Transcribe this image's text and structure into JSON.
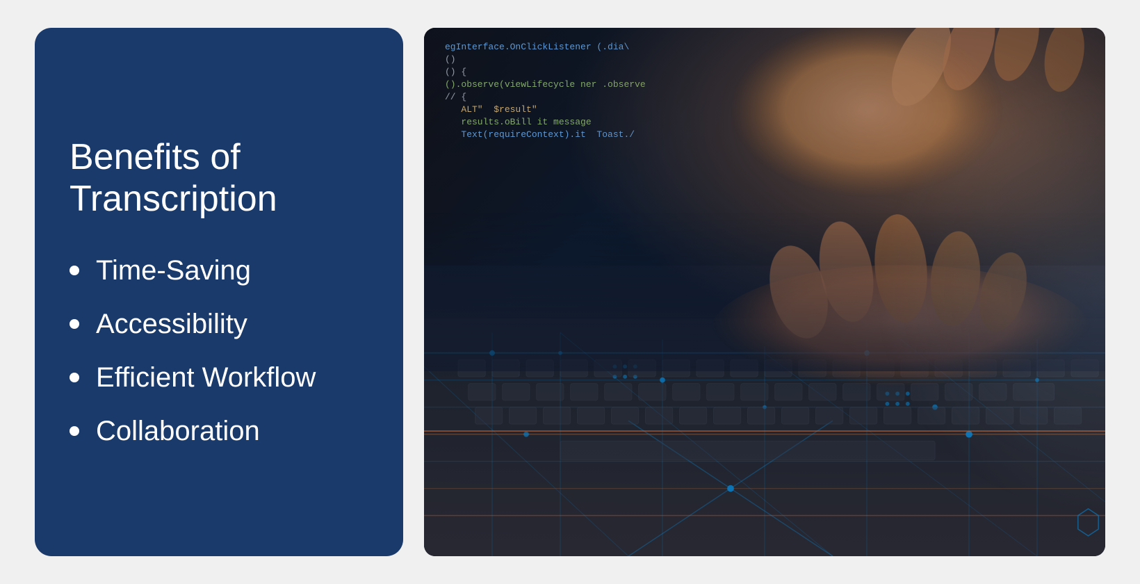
{
  "slide": {
    "left_panel": {
      "title_line1": "Benefits of",
      "title_line2": "Transcription",
      "bullet_items": [
        {
          "id": "time-saving",
          "label": "Time-Saving"
        },
        {
          "id": "accessibility",
          "label": "Accessibility"
        },
        {
          "id": "efficient-workflow",
          "label": "Efficient Workflow"
        },
        {
          "id": "collaboration",
          "label": "Collaboration"
        }
      ]
    },
    "right_panel": {
      "alt_text": "Hands typing on a keyboard with digital circuit overlay and code in background",
      "code_lines": [
        {
          "text": "egInterface.OnClickListener (.dia\\",
          "class": "blue"
        },
        {
          "text": "()",
          "class": "white"
        },
        {
          "text": "() {",
          "class": "white"
        },
        {
          "text": "().observe(viewLifecycle ner .observe",
          "class": "green"
        },
        {
          "text": "// {",
          "class": "white"
        },
        {
          "text": "   ALT\"  $result\"",
          "class": "yellow"
        },
        {
          "text": "   results.oBill it message",
          "class": "green"
        },
        {
          "text": "   Text(requireContext).it  Toast./",
          "class": "blue"
        }
      ]
    },
    "colors": {
      "panel_bg": "#1a3a6b",
      "text_color": "#ffffff",
      "accent": "#2563a8"
    }
  }
}
